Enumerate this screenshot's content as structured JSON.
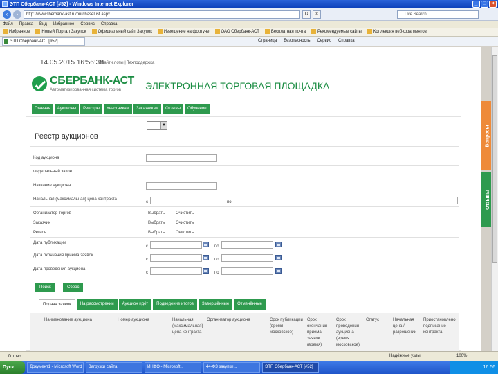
{
  "window": {
    "title": "ЭТП Сбербанк-АСТ [#52] - Windows Internet Explorer"
  },
  "address": {
    "url": "http://www.sberbank-ast.ru/purchaseList.aspx",
    "search_placeholder": "Live Search"
  },
  "menu": [
    "Файл",
    "Правка",
    "Вид",
    "Избранное",
    "Сервис",
    "Справка"
  ],
  "favorites": [
    "Избранное",
    "Новый Портал Закупок",
    "Официальный сайт Закупок",
    "Извещение на фортуне",
    "ОАО Сбербанк-АСТ",
    "Бесплатная почта",
    "Рекомендуемые сайты",
    "Коллекция веб-фрагментов"
  ],
  "ie_tab": "ЭТП Сбербанк-АСТ [#52]",
  "commands": [
    "Страница",
    "Безопасность",
    "Сервис",
    "Справка"
  ],
  "page": {
    "datetime": "14.05.2015 16:56:38",
    "top_links": "Найти лоты | Техподдержка",
    "logo_name": "СБЕРБАНК-АСТ",
    "logo_sub": "Автоматизированная система торгов",
    "platform_title": "ЭЛЕКТРОННАЯ ТОРГОВАЯ ПЛОЩАДКА",
    "nav": [
      "Главная",
      "Аукционы",
      "Реестры",
      "Участникам",
      "Заказчикам",
      "Отзывы",
      "Обучение"
    ],
    "registry_title": "Реестр аукционов",
    "filters": {
      "auction_number": "Код аукциона",
      "federal_law": "Федеральный закон",
      "auction_name": "Название аукциона",
      "initial_price": "Начальная (максимальная) цена контракта",
      "organizer": "Организатор торгов",
      "customer": "Заказчик",
      "region": "Регион",
      "publish_date": "Дата публикации",
      "end_date": "Дата окончания приема заявок",
      "auction_date": "Дата проведения аукциона",
      "from": "с",
      "to": "по",
      "select": "Выбрать",
      "clear": "Очистить"
    },
    "buttons": {
      "search": "Поиск",
      "reset": "Сброс"
    },
    "tabs": [
      "Подача заявок",
      "На рассмотрении",
      "Аукцион идёт",
      "Подведение итогов",
      "Завершённые",
      "Отменённые"
    ],
    "table_headers": [
      "Наименование аукциона",
      "Номер аукциона",
      "Начальная (максимальная) цена контракта",
      "Организатор аукциона",
      "Срок публикации (время московское)",
      "Срок окончания приема заявок (время)",
      "Срок проведения аукциона (время московское)",
      "Статус",
      "Начальная цена / разрешений",
      "Приостановлено подписание контракта"
    ],
    "side_tabs": [
      "Вопросы",
      "Отзывы"
    ]
  },
  "status": {
    "left": "Готово",
    "zone": "Надёжные узлы",
    "zoom": "100%"
  },
  "taskbar": {
    "start": "Пуск",
    "items": [
      "Документ1 - Microsoft Word",
      "Загрузки сайта",
      "ИНФО - Microsoft...",
      "44-ФЗ закупки...",
      "ЭТП Сбербанк-АСТ [#52]"
    ],
    "clock": "16:56"
  }
}
